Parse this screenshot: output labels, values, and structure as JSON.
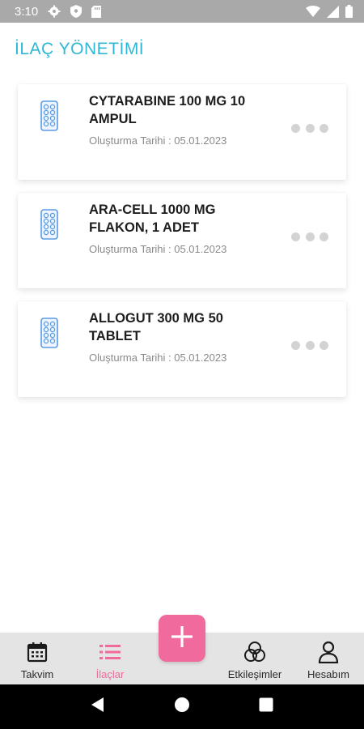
{
  "status_bar": {
    "time": "3:10",
    "icons": [
      "gear-icon",
      "shield-icon",
      "sd-card-icon",
      "wifi-icon",
      "signal-icon",
      "battery-icon"
    ]
  },
  "header": {
    "title": "İLAÇ YÖNETİMİ",
    "title_color": "#2fb8d6"
  },
  "medications": [
    {
      "name": "CYTARABINE 100 MG 10 AMPUL",
      "date": "Oluşturma Tarihi : 05.01.2023"
    },
    {
      "name": "ARA-CELL 1000 MG FLAKON, 1 ADET",
      "date": "Oluşturma Tarihi : 05.01.2023"
    },
    {
      "name": "ALLOGUT 300 MG 50 TABLET",
      "date": "Oluşturma Tarihi : 05.01.2023"
    }
  ],
  "bottom_nav": {
    "items": [
      {
        "label": "Takvim",
        "icon": "calendar-icon"
      },
      {
        "label": "İlaçlar",
        "icon": "list-icon",
        "active": true
      },
      {
        "label": "Etkileşimler",
        "icon": "interactions-icon"
      },
      {
        "label": "Hesabım",
        "icon": "person-icon"
      }
    ],
    "add_button_icon": "plus-icon",
    "accent_color": "#ee6b9c"
  },
  "system_nav": {
    "icons": [
      "back-icon",
      "home-icon",
      "recents-icon"
    ]
  }
}
